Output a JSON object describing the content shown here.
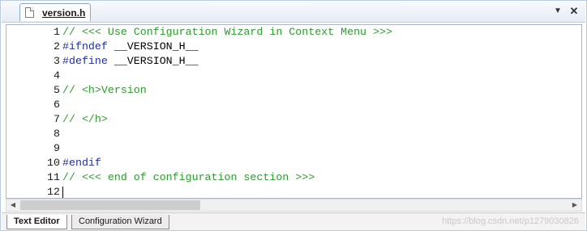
{
  "editor_tab": {
    "filename": "version.h",
    "dropdown_icon": "triangle-down",
    "close_icon": "x"
  },
  "code_lines": [
    {
      "number": "1",
      "segments": [
        {
          "text": "// <<< Use Configuration Wizard in Context Menu >>>",
          "kind": "comment"
        }
      ]
    },
    {
      "number": "2",
      "segments": [
        {
          "text": "#ifndef",
          "kind": "pre"
        },
        {
          "text": " __VERSION_H__",
          "kind": "plain"
        }
      ]
    },
    {
      "number": "3",
      "segments": [
        {
          "text": "#define",
          "kind": "pre"
        },
        {
          "text": " __VERSION_H__",
          "kind": "plain"
        }
      ]
    },
    {
      "number": "4",
      "segments": []
    },
    {
      "number": "5",
      "segments": [
        {
          "text": "// <h>Version",
          "kind": "comment"
        }
      ]
    },
    {
      "number": "6",
      "segments": []
    },
    {
      "number": "7",
      "segments": [
        {
          "text": "// </h>",
          "kind": "comment"
        }
      ]
    },
    {
      "number": "8",
      "segments": []
    },
    {
      "number": "9",
      "segments": []
    },
    {
      "number": "10",
      "segments": [
        {
          "text": "#endif",
          "kind": "pre"
        }
      ]
    },
    {
      "number": "11",
      "segments": [
        {
          "text": "// <<< end of configuration section >>>",
          "kind": "comment"
        }
      ]
    },
    {
      "number": "12",
      "segments": []
    }
  ],
  "bottom_tabs": [
    {
      "label": "Text Editor",
      "active": true
    },
    {
      "label": "Configuration Wizard",
      "active": false
    }
  ],
  "watermark": "https://blog.csdn.net/p1279030826",
  "colors": {
    "comment": "#2d9b2d",
    "preprocessor": "#1f2f9c",
    "plain": "#000000"
  }
}
